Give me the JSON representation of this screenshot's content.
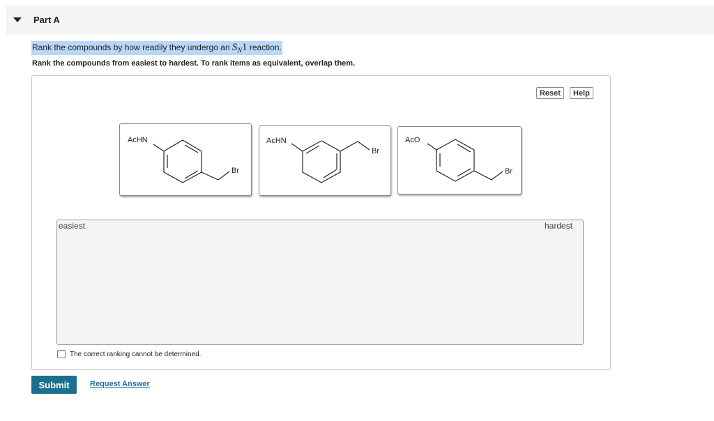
{
  "part": {
    "title": "Part A"
  },
  "question": {
    "prefix": "Rank the compounds by how readily they undergo an ",
    "s": "S",
    "sub": "N",
    "one": "1",
    "suffix": " reaction."
  },
  "instruction": "Rank the compounds from easiest to hardest. To rank items as equivalent, overlap them.",
  "toolbar": {
    "reset_label": "Reset",
    "help_label": "Help"
  },
  "compounds": [
    {
      "substituent": "AcHN",
      "leaving_group": "Br"
    },
    {
      "substituent": "AcHN",
      "leaving_group": "Br"
    },
    {
      "substituent": "AcO",
      "leaving_group": "Br"
    }
  ],
  "ranking": {
    "easiest_label": "easiest",
    "hardest_label": "hardest"
  },
  "cannot_determine_label": "The correct ranking cannot be determined.",
  "actions": {
    "submit_label": "Submit",
    "request_label": "Request Answer"
  }
}
